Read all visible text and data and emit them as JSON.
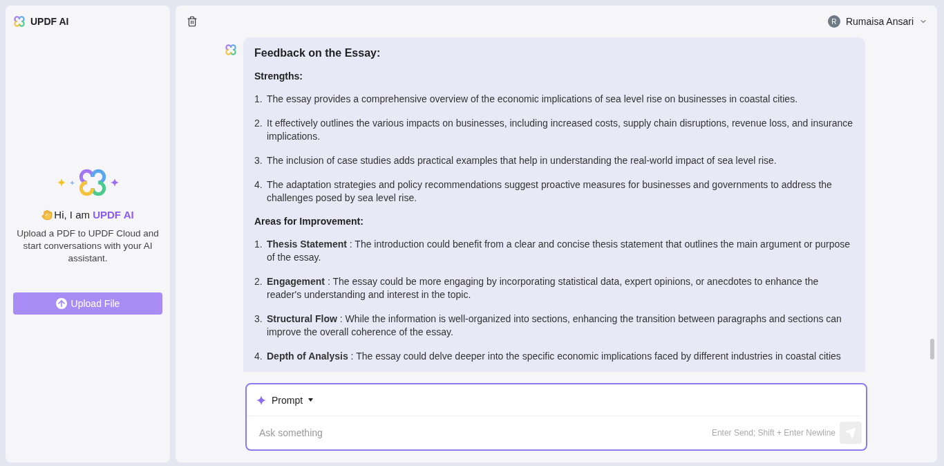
{
  "sidebar": {
    "brand": "UPDF AI",
    "greeting": "Hi, I am **UPDF AI**",
    "description": "Upload a PDF to UPDF Cloud and start conversations with your AI assistant.",
    "upload_button": "Upload File"
  },
  "header": {
    "user_initial": "R",
    "user_name": "Rumaisa Ansari"
  },
  "message": {
    "title": "Feedback on the Essay:",
    "sections": [
      {
        "heading": "Strengths:",
        "items": [
          {
            "number": "1.",
            "text": "The essay provides a comprehensive overview of the economic implications of sea level rise on businesses in coastal cities."
          },
          {
            "number": "2.",
            "text": "It effectively outlines the various impacts on businesses, including increased costs, supply chain disruptions, revenue loss, and insurance implications."
          },
          {
            "number": "3.",
            "text": "The inclusion of case studies adds practical examples that help in understanding the real-world impact of sea level rise."
          },
          {
            "number": "4.",
            "text": "The adaptation strategies and policy recommendations suggest proactive measures for businesses and governments to address the challenges posed by sea level rise."
          }
        ]
      },
      {
        "heading": "Areas for Improvement:",
        "items": [
          {
            "number": "1.",
            "text": "**Thesis Statement** : The introduction could benefit from a clear and concise thesis statement that outlines the main argument or purpose of the essay."
          },
          {
            "number": "2.",
            "text": "**Engagement** : The essay could be more engaging by incorporating statistical data, expert opinions, or anecdotes to enhance the reader's understanding and interest in the topic."
          },
          {
            "number": "3.",
            "text": "**Structural Flow** : While the information is well-organized into sections, enhancing the transition between paragraphs and sections can improve the overall coherence of the essay."
          },
          {
            "number": "4.",
            "text": "**Depth of Analysis** : The essay could delve deeper into the specific economic implications faced by different industries in coastal cities"
          }
        ]
      }
    ]
  },
  "composer": {
    "mode": "Prompt",
    "placeholder": "Ask something",
    "hint": "Enter Send; Shift + Enter Newline"
  }
}
